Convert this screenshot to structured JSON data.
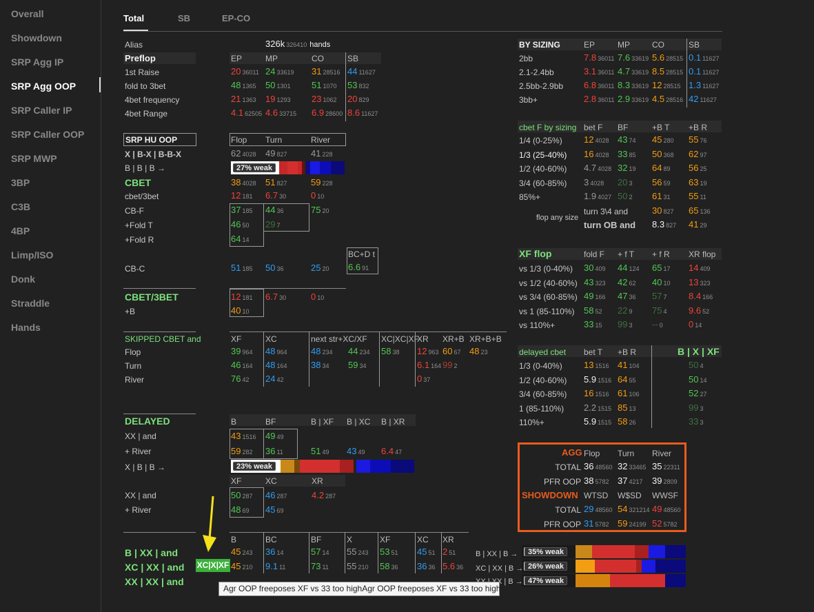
{
  "sidebar": {
    "items": [
      "Overall",
      "Showdown",
      "SRP Agg IP",
      "SRP Agg OOP",
      "SRP Caller IP",
      "SRP Caller OOP",
      "SRP MWP",
      "3BP",
      "C3B",
      "4BP",
      "Limp/ISO",
      "Donk",
      "Straddle",
      "Hands"
    ],
    "active": "SRP Agg OOP"
  },
  "tabs": [
    "Total",
    "SB",
    "EP-CO"
  ],
  "alias": {
    "label": "Alias",
    "hands_big": "326k",
    "hands_small": "326410",
    "hands_word": "hands"
  },
  "preflop": {
    "title": "Preflop",
    "cols": [
      "EP",
      "MP",
      "CO",
      "SB"
    ],
    "rows": [
      {
        "label": "1st Raise",
        "cells": [
          [
            "20",
            "36011",
            "r"
          ],
          [
            "24",
            "33619",
            "g"
          ],
          [
            "31",
            "28516",
            "o"
          ],
          [
            "44",
            "11627",
            "b"
          ]
        ]
      },
      {
        "label": "fold to 3bet",
        "cells": [
          [
            "48",
            "1365",
            "g"
          ],
          [
            "50",
            "1301",
            "g"
          ],
          [
            "51",
            "1070",
            "g"
          ],
          [
            "53",
            "832",
            "g"
          ]
        ]
      },
      {
        "label": "4bet frequency",
        "cells": [
          [
            "21",
            "1363",
            "r"
          ],
          [
            "19",
            "1293",
            "r"
          ],
          [
            "23",
            "1062",
            "r"
          ],
          [
            "20",
            "829",
            "r"
          ]
        ]
      },
      {
        "label": "4bet Range",
        "cells": [
          [
            "4.1",
            "62505",
            "r"
          ],
          [
            "4.6",
            "33715",
            "r"
          ],
          [
            "6.9",
            "28600",
            "r"
          ],
          [
            "8.6",
            "11627",
            "r"
          ]
        ]
      }
    ]
  },
  "srp": {
    "title": "SRP HU OOP",
    "cols": [
      "Flop",
      "Turn",
      "River"
    ],
    "line1": "X | B-X | B-B-X",
    "line1_vals": [
      [
        "62",
        "4028",
        "gr"
      ],
      [
        "49",
        "827",
        "gr"
      ],
      [
        "41",
        "228",
        "gr"
      ]
    ],
    "line2": "B | B | B →",
    "weak1": "27% weak",
    "cbet_title": "CBET",
    "cbet_vals": [
      [
        "38",
        "4028",
        "o"
      ],
      [
        "51",
        "827",
        "o"
      ],
      [
        "59",
        "228",
        "o"
      ]
    ],
    "rows": [
      {
        "label": "cbet/3bet",
        "cells": [
          [
            "12",
            "181",
            "r"
          ],
          [
            "6.7",
            "30",
            "r"
          ],
          [
            "0",
            "10",
            "r"
          ]
        ]
      },
      {
        "label": "CB-F",
        "cells": [
          [
            "37",
            "185",
            "g"
          ],
          [
            "44",
            "36",
            "g"
          ],
          [
            "75",
            "20",
            "g"
          ]
        ]
      },
      {
        "label": "+Fold T",
        "cells": [
          [
            "46",
            "50",
            "g"
          ],
          [
            "29",
            "7",
            "dg"
          ]
        ]
      },
      {
        "label": "+Fold R",
        "cells": [
          [
            "64",
            "14",
            "g"
          ]
        ]
      }
    ],
    "bcd": {
      "label": "BC+D t",
      "val": [
        "6.6",
        "91",
        "g"
      ]
    },
    "cbc": {
      "label": "CB-C",
      "cells": [
        [
          "51",
          "185",
          "b"
        ],
        [
          "50",
          "36",
          "b"
        ],
        [
          "25",
          "20",
          "b"
        ]
      ]
    }
  },
  "cbet3": {
    "title": "CBET/3BET",
    "sub": "+B",
    "row1": [
      [
        "12",
        "181",
        "r"
      ],
      [
        "6.7",
        "30",
        "r"
      ],
      [
        "0",
        "10",
        "r"
      ]
    ],
    "row2": [
      [
        "40",
        "10",
        "o"
      ]
    ]
  },
  "skipped": {
    "title": "SKIPPED CBET and",
    "cols": [
      "XF",
      "XC",
      "next str+XC/XF",
      "XC|XC|XF",
      "XR",
      "XR+B",
      "XR+B+B"
    ],
    "rows": [
      {
        "label": "Flop",
        "cells": [
          [
            "39",
            "964",
            "g"
          ],
          [
            "48",
            "964",
            "b"
          ],
          [
            "48",
            "234",
            "b"
          ],
          [
            "44",
            "234",
            "g"
          ],
          [
            "58",
            "38",
            "g"
          ],
          [
            "12",
            "963",
            "r"
          ],
          [
            "60",
            "67",
            "o"
          ],
          [
            "48",
            "23",
            "o"
          ]
        ]
      },
      {
        "label": "Turn",
        "cells": [
          [
            "46",
            "164",
            "g"
          ],
          [
            "48",
            "164",
            "b"
          ],
          [
            "38",
            "34",
            "b"
          ],
          [
            "59",
            "34",
            "g"
          ],
          [
            "",
            ""
          ],
          [
            "6.1",
            "164",
            "r"
          ],
          [
            "99",
            "2",
            "dr"
          ]
        ]
      },
      {
        "label": "River",
        "cells": [
          [
            "76",
            "42",
            "g"
          ],
          [
            "24",
            "42",
            "b"
          ],
          [
            "0",
            "37",
            "r"
          ]
        ]
      }
    ]
  },
  "delayed": {
    "title": "DELAYED",
    "cols": [
      "B",
      "BF",
      "B | XF",
      "B | XC",
      "B | XR"
    ],
    "r1": {
      "label": "XX | and",
      "cells": [
        [
          "43",
          "1516",
          "o"
        ],
        [
          "49",
          "49",
          "g"
        ]
      ]
    },
    "r2": {
      "label": "+ River",
      "cells": [
        [
          "59",
          "282",
          "o"
        ],
        [
          "36",
          "11",
          "g"
        ],
        [
          "51",
          "49",
          "g"
        ],
        [
          "43",
          "49",
          "b"
        ],
        [
          "6.4",
          "47",
          "r"
        ]
      ]
    },
    "r3": "X | B | B →",
    "weak2": "23% weak",
    "cols2": [
      "XF",
      "XC",
      "XR"
    ],
    "r4": {
      "label": "XX | and",
      "cells": [
        [
          "50",
          "287",
          "g"
        ],
        [
          "46",
          "287",
          "b"
        ],
        [
          "4.2",
          "287",
          "r"
        ]
      ]
    },
    "r5": {
      "label": "+ River",
      "cells": [
        [
          "48",
          "69",
          "g"
        ],
        [
          "45",
          "69",
          "b"
        ]
      ]
    }
  },
  "bottom": {
    "cols": [
      "B",
      "BC",
      "BF",
      "X",
      "XF",
      "XC",
      "XR"
    ],
    "badge": "XC|X|XF",
    "rows": [
      {
        "label": "B | XX | and",
        "cells": [
          [
            "45",
            "243",
            "o"
          ],
          [
            "36",
            "14",
            "b"
          ],
          [
            "57",
            "14",
            "g"
          ],
          [
            "55",
            "243",
            "gr"
          ],
          [
            "53",
            "51",
            "g"
          ],
          [
            "45",
            "51",
            "b"
          ],
          [
            "2",
            "51",
            "r"
          ]
        ],
        "arrow": "B | XX | B →",
        "weak": "35% weak"
      },
      {
        "label": "XC | XX | and",
        "cells": [
          [
            "45",
            "210",
            "o"
          ],
          [
            "9.1",
            "11",
            "b"
          ],
          [
            "73",
            "11",
            "g"
          ],
          [
            "55",
            "210",
            "gr"
          ],
          [
            "58",
            "36",
            "g"
          ],
          [
            "36",
            "36",
            "b"
          ],
          [
            "5.6",
            "36",
            "r"
          ]
        ],
        "arrow": "XC | XX | B →",
        "weak": "26% weak"
      },
      {
        "label": "XX | XX | and",
        "arrow": "XX | XX | B →",
        "weak": "47% weak"
      }
    ],
    "tooltip": "Agr OOP freeposes XF vs 33 too highAgr OOP freeposes XF vs 33 too high"
  },
  "sizing": {
    "title": "BY SIZING",
    "cols": [
      "EP",
      "MP",
      "CO",
      "SB"
    ],
    "rows": [
      {
        "label": "2bb",
        "cells": [
          [
            "7.8",
            "36011",
            "r"
          ],
          [
            "7.6",
            "33619",
            "g"
          ],
          [
            "5.6",
            "28515",
            "o"
          ],
          [
            "0.1",
            "11627",
            "b"
          ]
        ]
      },
      {
        "label": "2.1-2.4bb",
        "cells": [
          [
            "3.1",
            "36011",
            "r"
          ],
          [
            "4.7",
            "33619",
            "g"
          ],
          [
            "8.5",
            "28515",
            "o"
          ],
          [
            "0.1",
            "11627",
            "b"
          ]
        ]
      },
      {
        "label": "2.5bb-2.9bb",
        "cells": [
          [
            "6.8",
            "36011",
            "r"
          ],
          [
            "8.3",
            "33619",
            "g"
          ],
          [
            "12",
            "28515",
            "o"
          ],
          [
            "1.3",
            "11627",
            "b"
          ]
        ]
      },
      {
        "label": "3bb+",
        "cells": [
          [
            "2.8",
            "36011",
            "r"
          ],
          [
            "2.9",
            "33619",
            "g"
          ],
          [
            "4.5",
            "28516",
            "o"
          ],
          [
            "42",
            "11627",
            "b"
          ]
        ]
      }
    ]
  },
  "cbetf": {
    "title": "cbet F by sizing",
    "cols": [
      "bet F",
      "BF",
      "+B T",
      "+B R"
    ],
    "rows": [
      {
        "label": "1/4 (0-25%)",
        "cells": [
          [
            "12",
            "4028",
            "o"
          ],
          [
            "43",
            "74",
            "g"
          ],
          [
            "45",
            "280",
            "o"
          ],
          [
            "55",
            "76",
            "o"
          ]
        ]
      },
      {
        "label": "1/3 (25-40%)",
        "cells": [
          [
            "16",
            "4028",
            "o"
          ],
          [
            "33",
            "85",
            "g"
          ],
          [
            "50",
            "368",
            "o"
          ],
          [
            "62",
            "97",
            "o"
          ]
        ]
      },
      {
        "label": "1/2 (40-60%)",
        "cells": [
          [
            "4.7",
            "4028",
            "gr"
          ],
          [
            "32",
            "19",
            "g"
          ],
          [
            "64",
            "89",
            "o"
          ],
          [
            "56",
            "25",
            "o"
          ]
        ]
      },
      {
        "label": "3/4 (60-85%)",
        "cells": [
          [
            "3",
            "4028",
            "gr"
          ],
          [
            "20",
            "3",
            "dg"
          ],
          [
            "56",
            "59",
            "o"
          ],
          [
            "63",
            "19",
            "o"
          ]
        ]
      },
      {
        "label": "85%+",
        "cells": [
          [
            "1.9",
            "4027",
            "gr"
          ],
          [
            "50",
            "2",
            "dg"
          ],
          [
            "61",
            "31",
            "o"
          ],
          [
            "55",
            "11",
            "o"
          ]
        ]
      }
    ],
    "any": "flop any size",
    "turn34": "turn 3\\4 and",
    "turn34v": [
      [
        "30",
        "827",
        "o"
      ],
      [
        "65",
        "136",
        "o"
      ]
    ],
    "turnob": "turn OB and",
    "turnobv": [
      [
        "8.3",
        "827",
        "white"
      ],
      [
        "41",
        "29",
        "o"
      ]
    ]
  },
  "xf": {
    "title": "XF flop",
    "cols": [
      "fold F",
      "+ f T",
      "+ f R",
      "XR flop"
    ],
    "rows": [
      {
        "label": "vs 1/3 (0-40%)",
        "cells": [
          [
            "30",
            "409",
            "g"
          ],
          [
            "44",
            "124",
            "g"
          ],
          [
            "65",
            "17",
            "g"
          ],
          [
            "14",
            "409",
            "r"
          ]
        ]
      },
      {
        "label": "vs 1/2 (40-60%)",
        "cells": [
          [
            "43",
            "323",
            "g"
          ],
          [
            "42",
            "62",
            "g"
          ],
          [
            "40",
            "10",
            "g"
          ],
          [
            "13",
            "323",
            "r"
          ]
        ]
      },
      {
        "label": "vs 3/4 (60-85%)",
        "cells": [
          [
            "49",
            "166",
            "g"
          ],
          [
            "47",
            "36",
            "g"
          ],
          [
            "57",
            "7",
            "dg"
          ],
          [
            "8.4",
            "166",
            "r"
          ]
        ]
      },
      {
        "label": "vs 1 (85-110%)",
        "cells": [
          [
            "58",
            "52",
            "g"
          ],
          [
            "22",
            "9",
            "dg"
          ],
          [
            "75",
            "4",
            "dg"
          ],
          [
            "9.6",
            "52",
            "r"
          ]
        ]
      },
      {
        "label": "vs 110%+",
        "cells": [
          [
            "33",
            "15",
            "g"
          ],
          [
            "99",
            "3",
            "dg"
          ],
          [
            "--",
            "0",
            "dg"
          ],
          [
            "0",
            "14",
            "r"
          ]
        ]
      }
    ]
  },
  "dcbet": {
    "title": "delayed cbet",
    "cols": [
      "bet T",
      "+B R"
    ],
    "right": "B | X | XF",
    "rows": [
      {
        "label": "1/3 (0-40%)",
        "cells": [
          [
            "13",
            "1516",
            "o"
          ],
          [
            "41",
            "104",
            "o"
          ]
        ],
        "rv": [
          "50",
          "4",
          "dg"
        ]
      },
      {
        "label": "1/2 (40-60%)",
        "cells": [
          [
            "5.9",
            "1516",
            "white"
          ],
          [
            "64",
            "55",
            "o"
          ]
        ],
        "rv": [
          "50",
          "14",
          "g"
        ]
      },
      {
        "label": "3/4 (60-85%)",
        "cells": [
          [
            "16",
            "1516",
            "o"
          ],
          [
            "61",
            "106",
            "o"
          ]
        ],
        "rv": [
          "52",
          "27",
          "g"
        ]
      },
      {
        "label": "1 (85-110%)",
        "cells": [
          [
            "2.2",
            "1515",
            "gr"
          ],
          [
            "85",
            "13",
            "o"
          ]
        ],
        "rv": [
          "99",
          "3",
          "dg"
        ]
      },
      {
        "label": "110%+",
        "cells": [
          [
            "5.9",
            "1515",
            "white"
          ],
          [
            "58",
            "26",
            "o"
          ]
        ],
        "rv": [
          "33",
          "3",
          "dg"
        ]
      }
    ]
  },
  "agg": {
    "title": "AGG",
    "cols": [
      "Flop",
      "Turn",
      "River"
    ],
    "rows": [
      {
        "label": "TOTAL",
        "cells": [
          [
            "36",
            "48560",
            "white"
          ],
          [
            "32",
            "33465",
            "white"
          ],
          [
            "35",
            "22311",
            "white"
          ]
        ]
      },
      {
        "label": "PFR OOP",
        "cells": [
          [
            "38",
            "5782",
            "white"
          ],
          [
            "37",
            "4217",
            "white"
          ],
          [
            "39",
            "2809",
            "white"
          ]
        ]
      }
    ],
    "sd_title": "SHOWDOWN",
    "sd_cols": [
      "WTSD",
      "W$SD",
      "WWSF"
    ],
    "sd_rows": [
      {
        "label": "TOTAL",
        "cells": [
          [
            "29",
            "48560",
            "b"
          ],
          [
            "54",
            "321214",
            "o"
          ],
          [
            "49",
            "48560",
            "r"
          ]
        ]
      },
      {
        "label": "PFR OOP",
        "cells": [
          [
            "31",
            "5782",
            "b"
          ],
          [
            "59",
            "24199",
            "o"
          ],
          [
            "52",
            "5782",
            "r"
          ]
        ]
      }
    ]
  },
  "colors": {
    "red": "#f0433a",
    "green": "#52c752",
    "orange": "#f29d12",
    "blue": "#2f9df2",
    "accent_box": "#ea5b1c"
  }
}
